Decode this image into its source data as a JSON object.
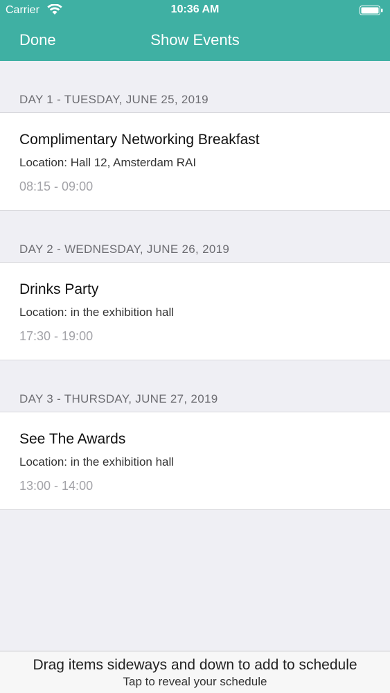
{
  "status_bar": {
    "carrier": "Carrier",
    "time": "10:36 AM"
  },
  "nav": {
    "done_label": "Done",
    "title": "Show Events"
  },
  "sections": [
    {
      "header": "DAY 1 - TUESDAY, JUNE 25, 2019",
      "events": [
        {
          "title": "Complimentary Networking Breakfast",
          "location": "Location: Hall 12, Amsterdam RAI",
          "time": "08:15 - 09:00"
        }
      ]
    },
    {
      "header": "DAY 2 - WEDNESDAY, JUNE 26, 2019",
      "events": [
        {
          "title": "Drinks Party",
          "location": "Location: in the exhibition hall",
          "time": "17:30 - 19:00"
        }
      ]
    },
    {
      "header": "DAY 3 - THURSDAY, JUNE 27, 2019",
      "events": [
        {
          "title": "See The Awards",
          "location": "Location: in the exhibition hall",
          "time": "13:00 - 14:00"
        }
      ]
    }
  ],
  "bottom_bar": {
    "drag_hint": "Drag items sideways and down to add to schedule",
    "tap_hint": "Tap to reveal your schedule"
  },
  "colors": {
    "accent": "#3fb0a3",
    "background": "#efeff4",
    "time_text": "#a3a3a8"
  },
  "icons": [
    "wifi-icon",
    "battery-icon"
  ]
}
